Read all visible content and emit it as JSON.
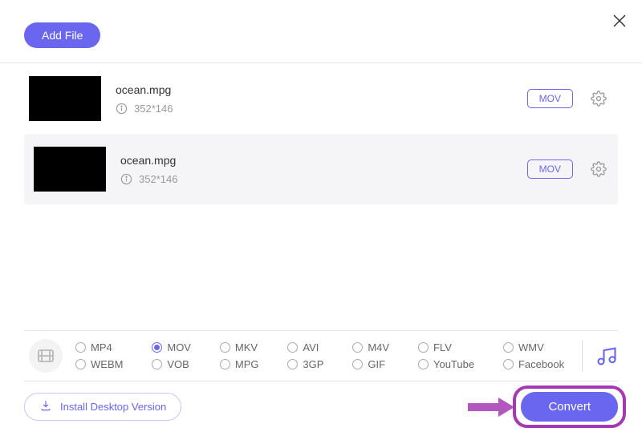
{
  "header": {
    "add_file_label": "Add File"
  },
  "files": [
    {
      "name": "ocean.mpg",
      "dimensions": "352*146",
      "format": "MOV"
    },
    {
      "name": "ocean.mpg",
      "dimensions": "352*146",
      "format": "MOV"
    }
  ],
  "formats": {
    "row1": [
      "MP4",
      "MOV",
      "MKV",
      "AVI",
      "M4V",
      "FLV",
      "WMV"
    ],
    "row2": [
      "WEBM",
      "VOB",
      "MPG",
      "3GP",
      "GIF",
      "YouTube",
      "Facebook"
    ],
    "selected": "MOV"
  },
  "footer": {
    "install_label": "Install Desktop Version",
    "convert_label": "Convert"
  }
}
